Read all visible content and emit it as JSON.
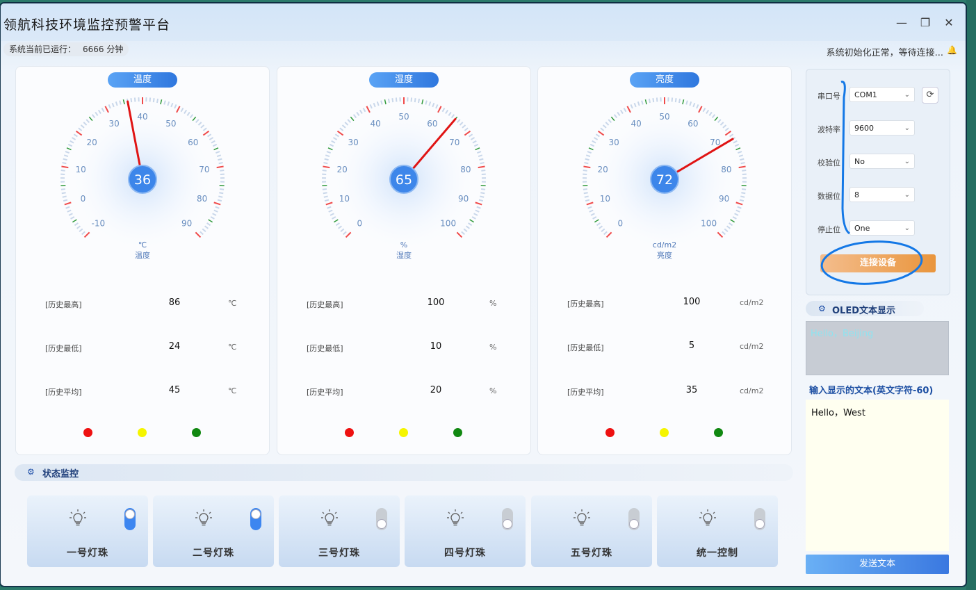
{
  "window": {
    "title": "领航科技环境监控预警平台",
    "minimize_icon": "minimize-icon",
    "restore_icon": "restore-icon",
    "close_icon": "close-icon",
    "minimize_glyph": "—",
    "restore_glyph": "❐",
    "close_glyph": "✕"
  },
  "status": {
    "runtime_label": "系统当前已运行：",
    "runtime_value": "6666 分钟",
    "message": "系统初始化正常，等待连接...",
    "bell_glyph": "🔔"
  },
  "gauges": [
    {
      "tag": "温度",
      "value": "36",
      "value_num": 36,
      "min": -10,
      "max": 90,
      "ticks": [
        "-10",
        "0",
        "10",
        "20",
        "30",
        "40",
        "50",
        "60",
        "70",
        "80",
        "90"
      ],
      "unit": "℃",
      "name": "温度",
      "history": [
        {
          "label": "[历史最高]",
          "value": "86",
          "unit": "℃"
        },
        {
          "label": "[历史最低]",
          "value": "24",
          "unit": "℃"
        },
        {
          "label": "[历史平均]",
          "value": "45",
          "unit": "℃"
        }
      ]
    },
    {
      "tag": "湿度",
      "value": "65",
      "value_num": 65,
      "min": 0,
      "max": 100,
      "ticks": [
        "0",
        "10",
        "20",
        "30",
        "40",
        "50",
        "60",
        "70",
        "80",
        "90",
        "100"
      ],
      "unit": "%",
      "name": "湿度",
      "history": [
        {
          "label": "[历史最高]",
          "value": "100",
          "unit": "%"
        },
        {
          "label": "[历史最低]",
          "value": "10",
          "unit": "%"
        },
        {
          "label": "[历史平均]",
          "value": "20",
          "unit": "%"
        }
      ]
    },
    {
      "tag": "亮度",
      "value": "72",
      "value_num": 72,
      "min": 0,
      "max": 100,
      "ticks": [
        "0",
        "10",
        "20",
        "30",
        "40",
        "50",
        "60",
        "70",
        "80",
        "90",
        "100"
      ],
      "unit": "cd/m2",
      "name": "亮度",
      "history": [
        {
          "label": "[历史最高]",
          "value": "100",
          "unit": "cd/m2"
        },
        {
          "label": "[历史最低]",
          "value": "5",
          "unit": "cd/m2"
        },
        {
          "label": "[历史平均]",
          "value": "35",
          "unit": "cd/m2"
        }
      ]
    }
  ],
  "indicator_colors": [
    "#ee1111",
    "#f5f500",
    "#118811"
  ],
  "state_section": {
    "label": "状态监控",
    "icon_glyph": "⚙"
  },
  "leds": [
    {
      "name": "一号灯珠",
      "on": true
    },
    {
      "name": "二号灯珠",
      "on": true
    },
    {
      "name": "三号灯珠",
      "on": false
    },
    {
      "name": "四号灯珠",
      "on": false
    },
    {
      "name": "五号灯珠",
      "on": false
    },
    {
      "name": "统一控制",
      "on": false
    }
  ],
  "serial": {
    "fields": [
      {
        "label": "串口号",
        "value": "COM1"
      },
      {
        "label": "波特率",
        "value": "9600"
      },
      {
        "label": "校验位",
        "value": "No"
      },
      {
        "label": "数据位",
        "value": "8"
      },
      {
        "label": "停止位",
        "value": "One"
      }
    ],
    "refresh_glyph": "⟳",
    "chevron_glyph": "⌄",
    "connect_label": "连接设备"
  },
  "oled": {
    "section_label": "OLED文本显示",
    "icon_glyph": "⚙",
    "screen_text": "Hello，Beijing",
    "input_title": "输入显示的文本(英文字符-60)",
    "input_value": "Hello，West",
    "send_label": "发送文本"
  }
}
